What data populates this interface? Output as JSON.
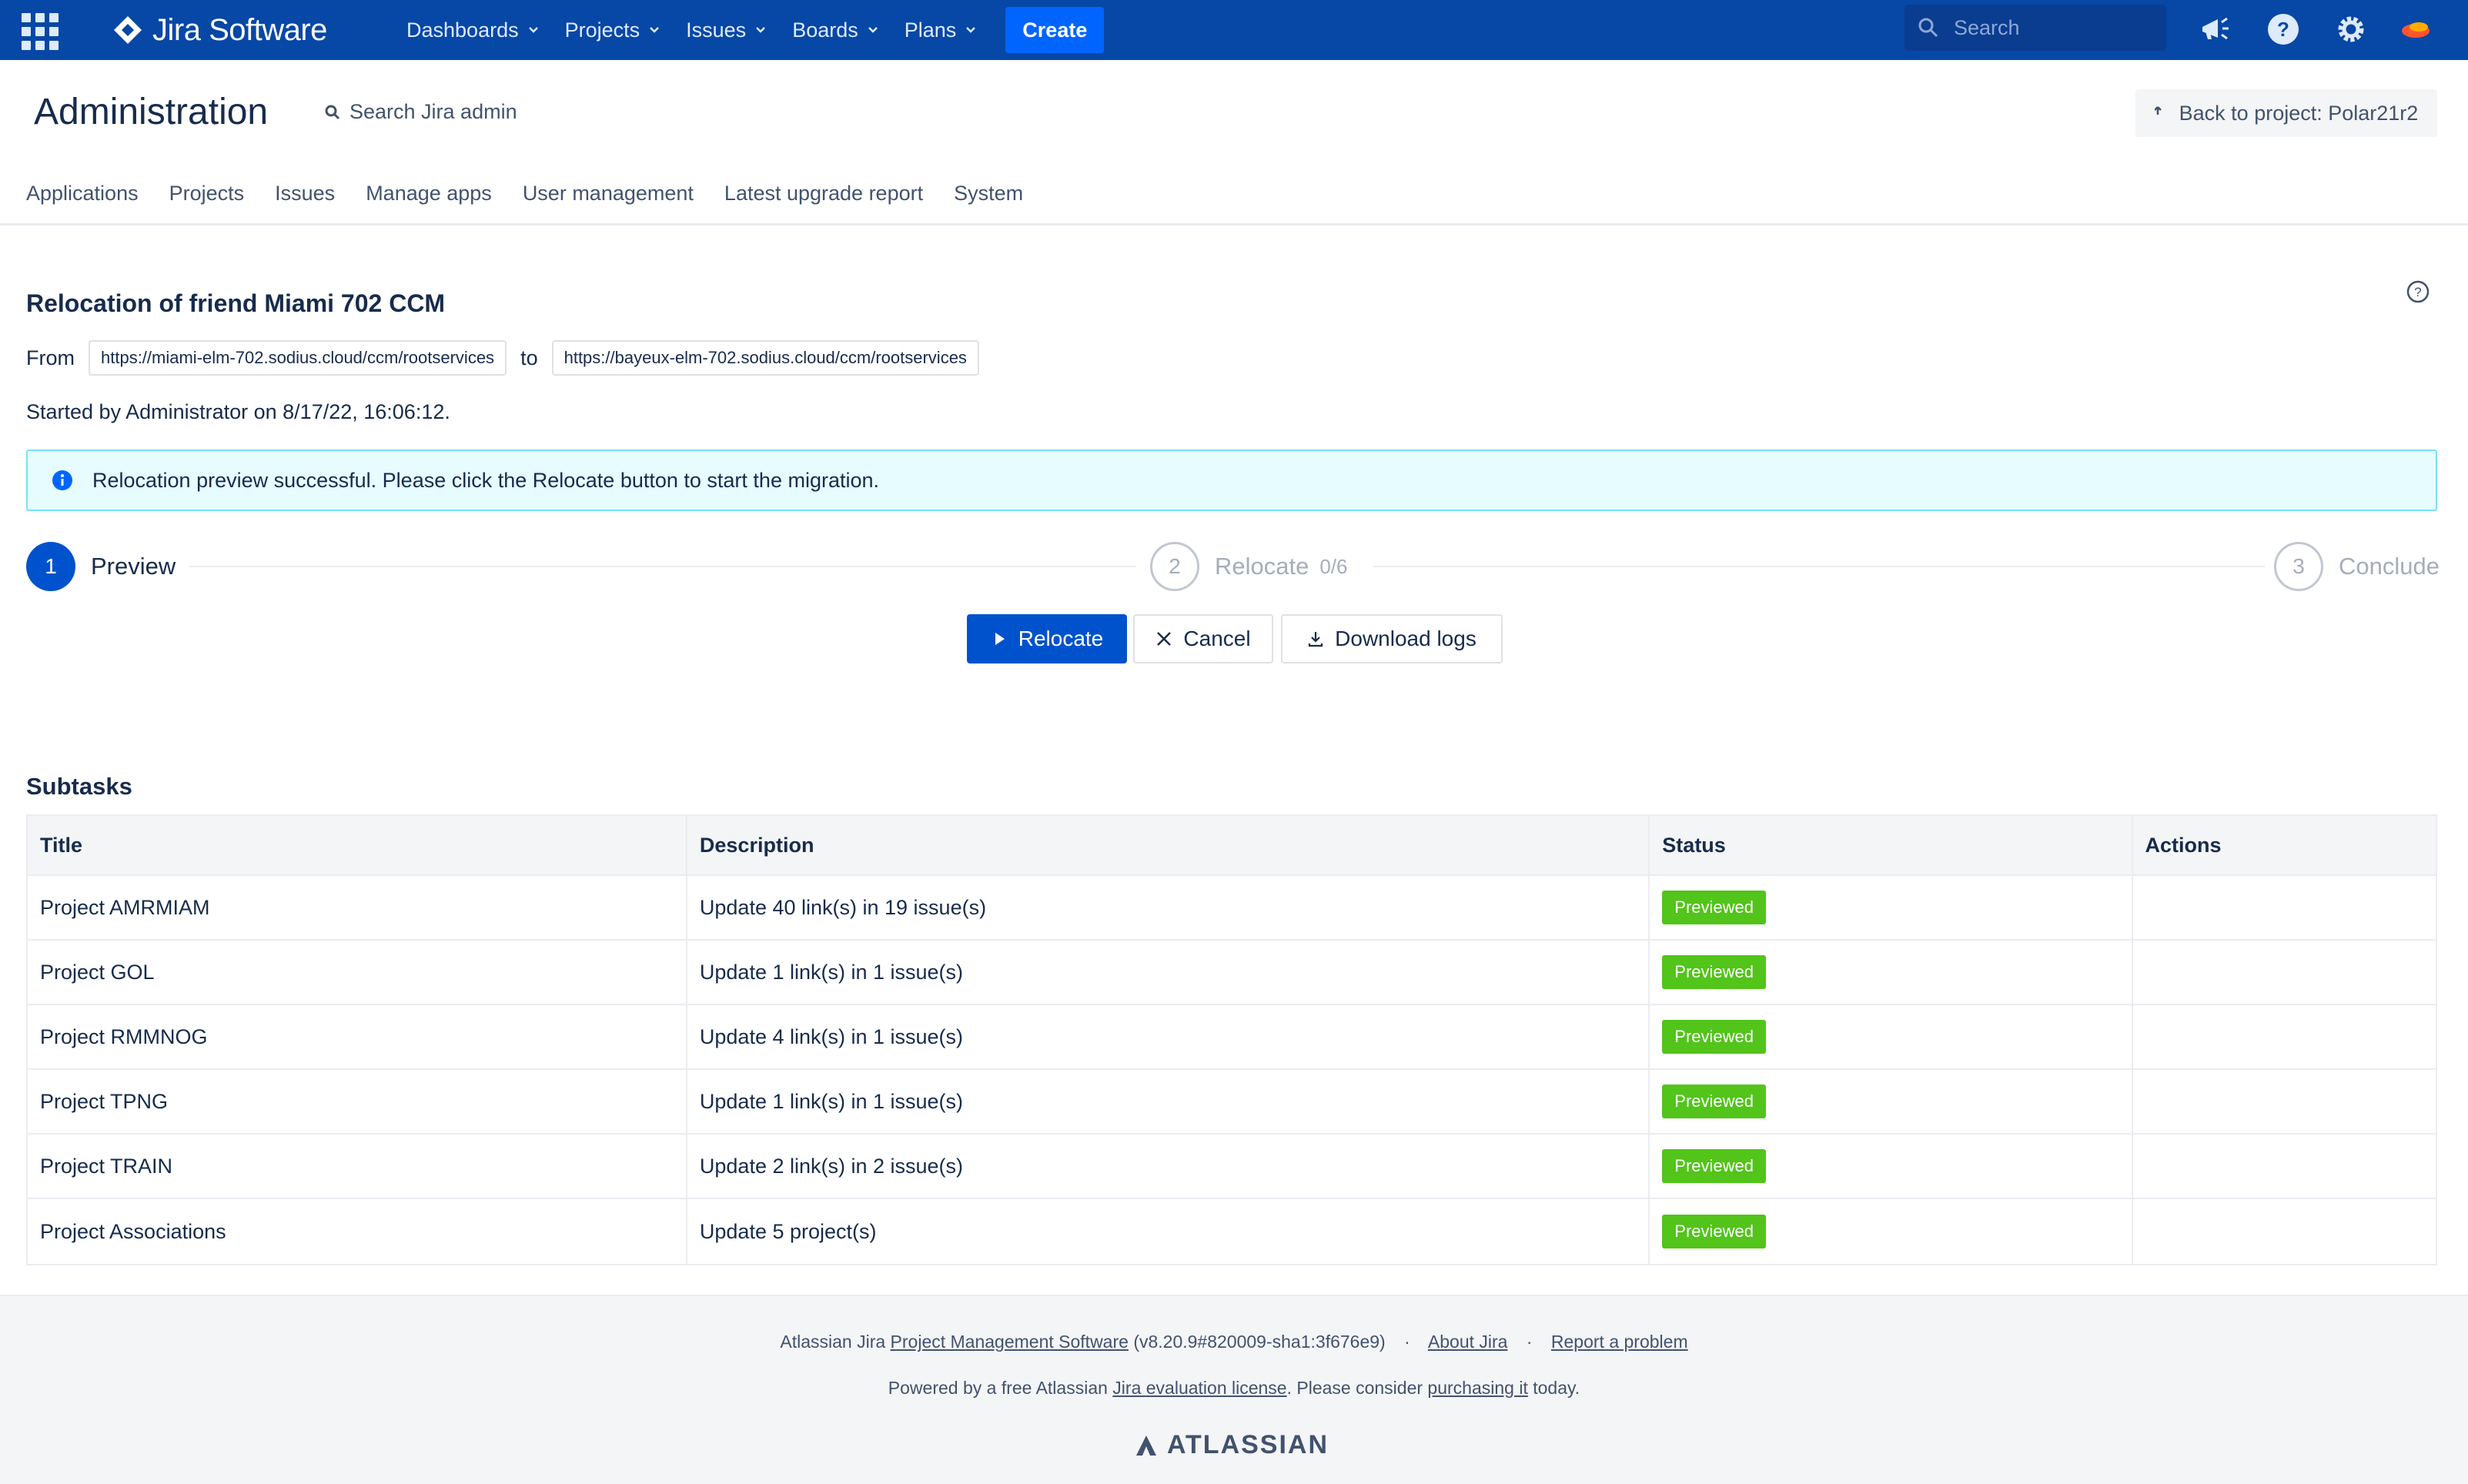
{
  "topnav": {
    "logo_text": "Jira Software",
    "menu": [
      {
        "label": "Dashboards"
      },
      {
        "label": "Projects"
      },
      {
        "label": "Issues"
      },
      {
        "label": "Boards"
      },
      {
        "label": "Plans"
      }
    ],
    "create_label": "Create",
    "search_placeholder": "Search",
    "colors": {
      "bar": "#0747a6",
      "create": "#0065ff"
    }
  },
  "admin": {
    "title": "Administration",
    "search_label": "Search Jira admin",
    "back_label": "Back to project: Polar21r2",
    "tabs": [
      "Applications",
      "Projects",
      "Issues",
      "Manage apps",
      "User management",
      "Latest upgrade report",
      "System"
    ]
  },
  "relocation": {
    "title": "Relocation of friend Miami 702 CCM",
    "from_label": "From",
    "from_url": "https://miami-elm-702.sodius.cloud/ccm/rootservices",
    "to_label": "to",
    "to_url": "https://bayeux-elm-702.sodius.cloud/ccm/rootservices",
    "started": "Started by Administrator on 8/17/22, 16:06:12.",
    "banner": "Relocation preview successful. Please click the Relocate button to start the migration.",
    "steps": [
      {
        "number": "1",
        "label": "Preview",
        "count": ""
      },
      {
        "number": "2",
        "label": "Relocate",
        "count": "0/6"
      },
      {
        "number": "3",
        "label": "Conclude",
        "count": ""
      }
    ],
    "buttons": {
      "relocate": "Relocate",
      "cancel": "Cancel",
      "download": "Download logs"
    }
  },
  "subtasks": {
    "title": "Subtasks",
    "columns": [
      "Title",
      "Description",
      "Status",
      "Actions"
    ],
    "rows": [
      {
        "title": "Project AMRMIAM",
        "description": "Update 40 link(s) in 19 issue(s)",
        "status": "Previewed"
      },
      {
        "title": "Project GOL",
        "description": "Update 1 link(s) in 1 issue(s)",
        "status": "Previewed"
      },
      {
        "title": "Project RMMNOG",
        "description": "Update 4 link(s) in 1 issue(s)",
        "status": "Previewed"
      },
      {
        "title": "Project TPNG",
        "description": "Update 1 link(s) in 1 issue(s)",
        "status": "Previewed"
      },
      {
        "title": "Project TRAIN",
        "description": "Update 2 link(s) in 2 issue(s)",
        "status": "Previewed"
      },
      {
        "title": "Project Associations",
        "description": "Update 5 project(s)",
        "status": "Previewed"
      }
    ],
    "status_color": "#52c41a"
  },
  "footer": {
    "line1_prefix": "Atlassian Jira",
    "line1_link1": "Project Management Software",
    "line1_version": "(v8.20.9#820009-sha1:3f676e9)",
    "line1_sep": "·",
    "line1_link2": "About Jira",
    "line1_link3": "Report a problem",
    "line2_prefix": "Powered by a free Atlassian",
    "line2_link1": "Jira evaluation license",
    "line2_mid": ". Please consider",
    "line2_link2": "purchasing it",
    "line2_suffix": "today.",
    "brand": "ATLASSIAN"
  }
}
